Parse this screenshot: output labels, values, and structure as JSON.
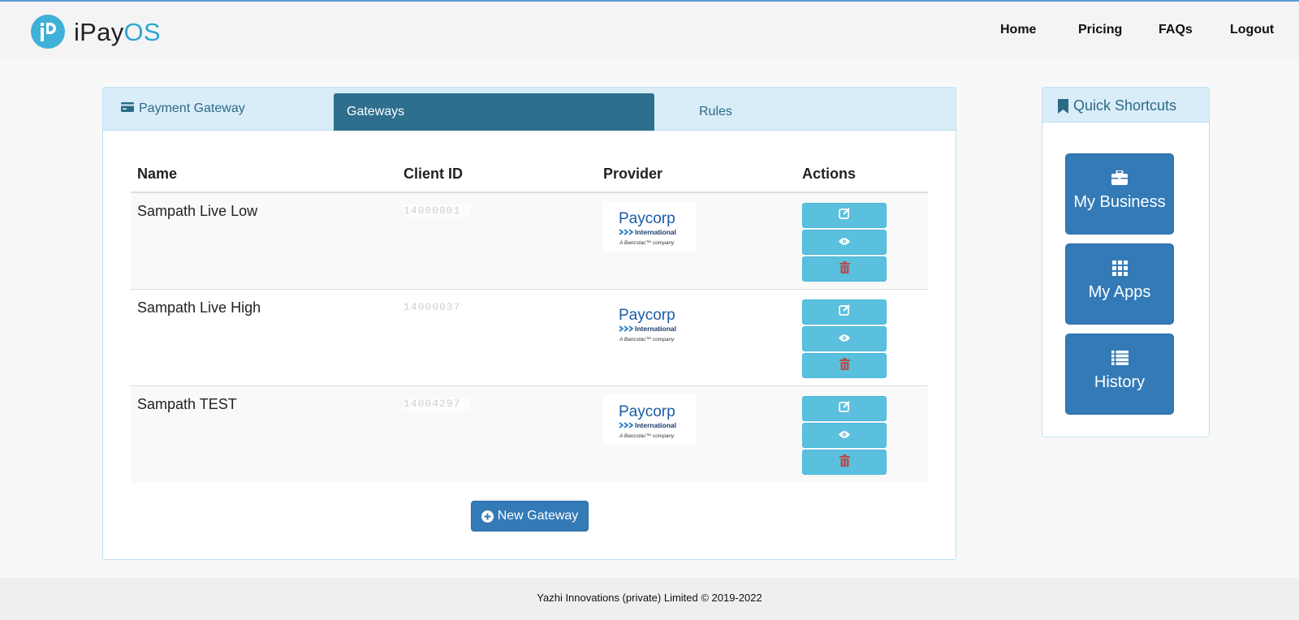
{
  "header": {
    "brand_prefix": "iPay",
    "brand_suffix": "OS",
    "nav": [
      {
        "label": "Home"
      },
      {
        "label": "Pricing"
      },
      {
        "label": "FAQs"
      },
      {
        "label": "Logout"
      }
    ]
  },
  "panel": {
    "title": "Payment Gateway",
    "tabs": [
      {
        "label": "Gateways",
        "active": true
      },
      {
        "label": "Rules",
        "active": false
      }
    ],
    "columns": [
      "Name",
      "Client ID",
      "Provider",
      "Actions"
    ],
    "rows": [
      {
        "name": "Sampath Live Low",
        "client_id": "14000001",
        "provider": {
          "name": "Paycorp",
          "subtitle": "International",
          "tagline": "A Bancstac™ company"
        }
      },
      {
        "name": "Sampath Live High",
        "client_id": "14000037",
        "provider": {
          "name": "Paycorp",
          "subtitle": "International",
          "tagline": "A Bancstac™ company"
        }
      },
      {
        "name": "Sampath TEST",
        "client_id": "14004297",
        "provider": {
          "name": "Paycorp",
          "subtitle": "International",
          "tagline": "A Bancstac™ company"
        }
      }
    ],
    "new_button": "New Gateway"
  },
  "shortcuts": {
    "title": "Quick Shortcuts",
    "items": [
      {
        "label": "My Business",
        "icon": "briefcase-icon"
      },
      {
        "label": "My Apps",
        "icon": "grid-icon"
      },
      {
        "label": "History",
        "icon": "list-icon"
      }
    ]
  },
  "footer": {
    "text": "Yazhi Innovations (private) Limited © 2019-2022"
  },
  "colors": {
    "primary": "#337ab7",
    "info": "#5bc0de",
    "tab_active": "#2e6f8e",
    "panel_head": "#d9edf8",
    "danger_icon": "#b94a48",
    "brand": "#3fb1d8"
  }
}
